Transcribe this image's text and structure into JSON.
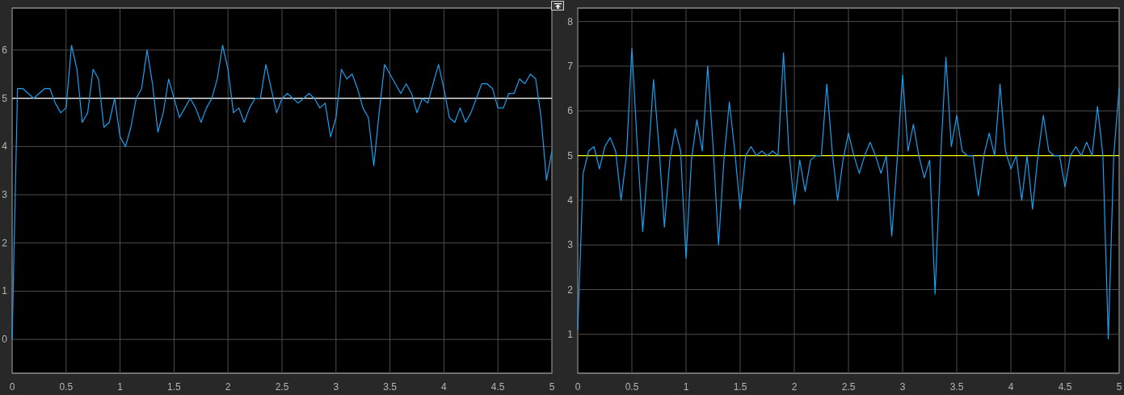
{
  "scopes": [
    {
      "chart_data": {
        "type": "line",
        "grid": true,
        "xlim": [
          0,
          5
        ],
        "ylim": [
          -0.7,
          6.87
        ],
        "xticks": [
          0,
          0.5,
          1,
          1.5,
          2,
          2.5,
          3,
          3.5,
          4,
          4.5,
          5
        ],
        "yticks": [
          0,
          1,
          2,
          3,
          4,
          5,
          6
        ],
        "x": [
          0,
          0.05,
          0.1,
          0.15,
          0.2,
          0.25,
          0.3,
          0.35,
          0.4,
          0.45,
          0.5,
          0.55,
          0.6,
          0.65,
          0.7,
          0.75,
          0.8,
          0.85,
          0.9,
          0.95,
          1,
          1.05,
          1.1,
          1.15,
          1.2,
          1.25,
          1.3,
          1.35,
          1.4,
          1.45,
          1.5,
          1.55,
          1.6,
          1.65,
          1.7,
          1.75,
          1.8,
          1.85,
          1.9,
          1.95,
          2,
          2.05,
          2.1,
          2.15,
          2.2,
          2.25,
          2.3,
          2.35,
          2.4,
          2.45,
          2.5,
          2.55,
          2.6,
          2.65,
          2.7,
          2.75,
          2.8,
          2.85,
          2.9,
          2.95,
          3,
          3.05,
          3.1,
          3.15,
          3.2,
          3.25,
          3.3,
          3.35,
          3.4,
          3.45,
          3.5,
          3.55,
          3.6,
          3.65,
          3.7,
          3.75,
          3.8,
          3.85,
          3.9,
          3.95,
          4,
          4.05,
          4.1,
          4.15,
          4.2,
          4.25,
          4.3,
          4.35,
          4.4,
          4.45,
          4.5,
          4.55,
          4.6,
          4.65,
          4.7,
          4.75,
          4.8,
          4.85,
          4.9,
          4.95,
          5
        ],
        "series": [
          {
            "color": "#ffffff",
            "values": [
              5,
              5,
              5,
              5,
              5,
              5,
              5,
              5,
              5,
              5,
              5,
              5,
              5,
              5,
              5,
              5,
              5,
              5,
              5,
              5,
              5,
              5,
              5,
              5,
              5,
              5,
              5,
              5,
              5,
              5,
              5,
              5,
              5,
              5,
              5,
              5,
              5,
              5,
              5,
              5,
              5,
              5,
              5,
              5,
              5,
              5,
              5,
              5,
              5,
              5,
              5,
              5,
              5,
              5,
              5,
              5,
              5,
              5,
              5,
              5,
              5,
              5,
              5,
              5,
              5,
              5,
              5,
              5,
              5,
              5,
              5,
              5,
              5,
              5,
              5,
              5,
              5,
              5,
              5,
              5,
              5,
              5,
              5,
              5,
              5,
              5,
              5,
              5,
              5,
              5,
              5,
              5,
              5,
              5,
              5,
              5,
              5,
              5,
              5,
              5,
              5
            ]
          },
          {
            "color": "#1a9ff0",
            "values": [
              0,
              5.2,
              5.2,
              5.1,
              5.0,
              5.1,
              5.2,
              5.2,
              4.9,
              4.7,
              4.8,
              6.1,
              5.6,
              4.5,
              4.7,
              5.6,
              5.4,
              4.4,
              4.5,
              5.0,
              4.2,
              4.0,
              4.4,
              5.0,
              5.2,
              6.0,
              5.3,
              4.3,
              4.7,
              5.4,
              5.0,
              4.6,
              4.8,
              5.0,
              4.8,
              4.5,
              4.8,
              5.0,
              5.4,
              6.1,
              5.6,
              4.7,
              4.8,
              4.5,
              4.8,
              5.0,
              5.0,
              5.7,
              5.2,
              4.7,
              5.0,
              5.1,
              5.0,
              4.9,
              5.0,
              5.1,
              5.0,
              4.8,
              4.9,
              4.2,
              4.6,
              5.6,
              5.4,
              5.5,
              5.2,
              4.8,
              4.6,
              3.6,
              4.7,
              5.7,
              5.5,
              5.3,
              5.1,
              5.3,
              5.1,
              4.7,
              5.0,
              4.9,
              5.3,
              5.7,
              5.2,
              4.6,
              4.5,
              4.8,
              4.5,
              4.7,
              5.0,
              5.3,
              5.3,
              5.2,
              4.8,
              4.8,
              5.1,
              5.1,
              5.4,
              5.3,
              5.5,
              5.4,
              4.6,
              3.3,
              3.9
            ]
          }
        ]
      }
    },
    {
      "chart_data": {
        "type": "line",
        "grid": true,
        "xlim": [
          0,
          5
        ],
        "ylim": [
          0.13,
          8.3
        ],
        "xticks": [
          0,
          0.5,
          1,
          1.5,
          2,
          2.5,
          3,
          3.5,
          4,
          4.5,
          5
        ],
        "yticks": [
          1,
          2,
          3,
          4,
          5,
          6,
          7,
          8
        ],
        "x": [
          0,
          0.05,
          0.1,
          0.15,
          0.2,
          0.25,
          0.3,
          0.35,
          0.4,
          0.45,
          0.5,
          0.55,
          0.6,
          0.65,
          0.7,
          0.75,
          0.8,
          0.85,
          0.9,
          0.95,
          1,
          1.05,
          1.1,
          1.15,
          1.2,
          1.25,
          1.3,
          1.35,
          1.4,
          1.45,
          1.5,
          1.55,
          1.6,
          1.65,
          1.7,
          1.75,
          1.8,
          1.85,
          1.9,
          1.95,
          2,
          2.05,
          2.1,
          2.15,
          2.2,
          2.25,
          2.3,
          2.35,
          2.4,
          2.45,
          2.5,
          2.55,
          2.6,
          2.65,
          2.7,
          2.75,
          2.8,
          2.85,
          2.9,
          2.95,
          3,
          3.05,
          3.1,
          3.15,
          3.2,
          3.25,
          3.3,
          3.35,
          3.4,
          3.45,
          3.5,
          3.55,
          3.6,
          3.65,
          3.7,
          3.75,
          3.8,
          3.85,
          3.9,
          3.95,
          4,
          4.05,
          4.1,
          4.15,
          4.2,
          4.25,
          4.3,
          4.35,
          4.4,
          4.45,
          4.5,
          4.55,
          4.6,
          4.65,
          4.7,
          4.75,
          4.8,
          4.85,
          4.9,
          4.95,
          5
        ],
        "series": [
          {
            "color": "#ffff00",
            "values": [
              5,
              5,
              5,
              5,
              5,
              5,
              5,
              5,
              5,
              5,
              5,
              5,
              5,
              5,
              5,
              5,
              5,
              5,
              5,
              5,
              5,
              5,
              5,
              5,
              5,
              5,
              5,
              5,
              5,
              5,
              5,
              5,
              5,
              5,
              5,
              5,
              5,
              5,
              5,
              5,
              5,
              5,
              5,
              5,
              5,
              5,
              5,
              5,
              5,
              5,
              5,
              5,
              5,
              5,
              5,
              5,
              5,
              5,
              5,
              5,
              5,
              5,
              5,
              5,
              5,
              5,
              5,
              5,
              5,
              5,
              5,
              5,
              5,
              5,
              5,
              5,
              5,
              5,
              5,
              5,
              5,
              5,
              5,
              5,
              5,
              5,
              5,
              5,
              5,
              5,
              5,
              5,
              5,
              5,
              5,
              5,
              5,
              5,
              5,
              5,
              5
            ]
          },
          {
            "color": "#1a9ff0",
            "values": [
              1.1,
              4.6,
              5.1,
              5.2,
              4.7,
              5.2,
              5.4,
              5.1,
              4.0,
              5.0,
              7.4,
              5.2,
              3.3,
              4.9,
              6.7,
              5.2,
              3.4,
              4.9,
              5.6,
              5.1,
              2.7,
              4.9,
              5.8,
              5.1,
              7.0,
              5.2,
              3.0,
              4.9,
              6.2,
              5.1,
              3.8,
              5.0,
              5.2,
              5.0,
              5.1,
              5.0,
              5.1,
              5.0,
              7.3,
              5.1,
              3.9,
              4.9,
              4.2,
              4.9,
              5.0,
              5.0,
              6.6,
              5.1,
              4.0,
              4.9,
              5.5,
              5.0,
              4.6,
              5.0,
              5.3,
              5.0,
              4.6,
              5.0,
              3.2,
              4.9,
              6.8,
              5.1,
              5.7,
              5.0,
              4.5,
              4.9,
              1.9,
              4.9,
              7.2,
              5.2,
              5.9,
              5.1,
              5.0,
              5.0,
              4.1,
              5.0,
              5.5,
              5.0,
              6.6,
              5.1,
              4.7,
              5.0,
              4.0,
              5.0,
              3.8,
              5.0,
              5.9,
              5.1,
              5.0,
              5.0,
              4.3,
              5.0,
              5.2,
              5.0,
              5.3,
              5.0,
              6.1,
              5.0,
              0.9,
              5.0,
              6.5
            ]
          }
        ]
      }
    }
  ]
}
